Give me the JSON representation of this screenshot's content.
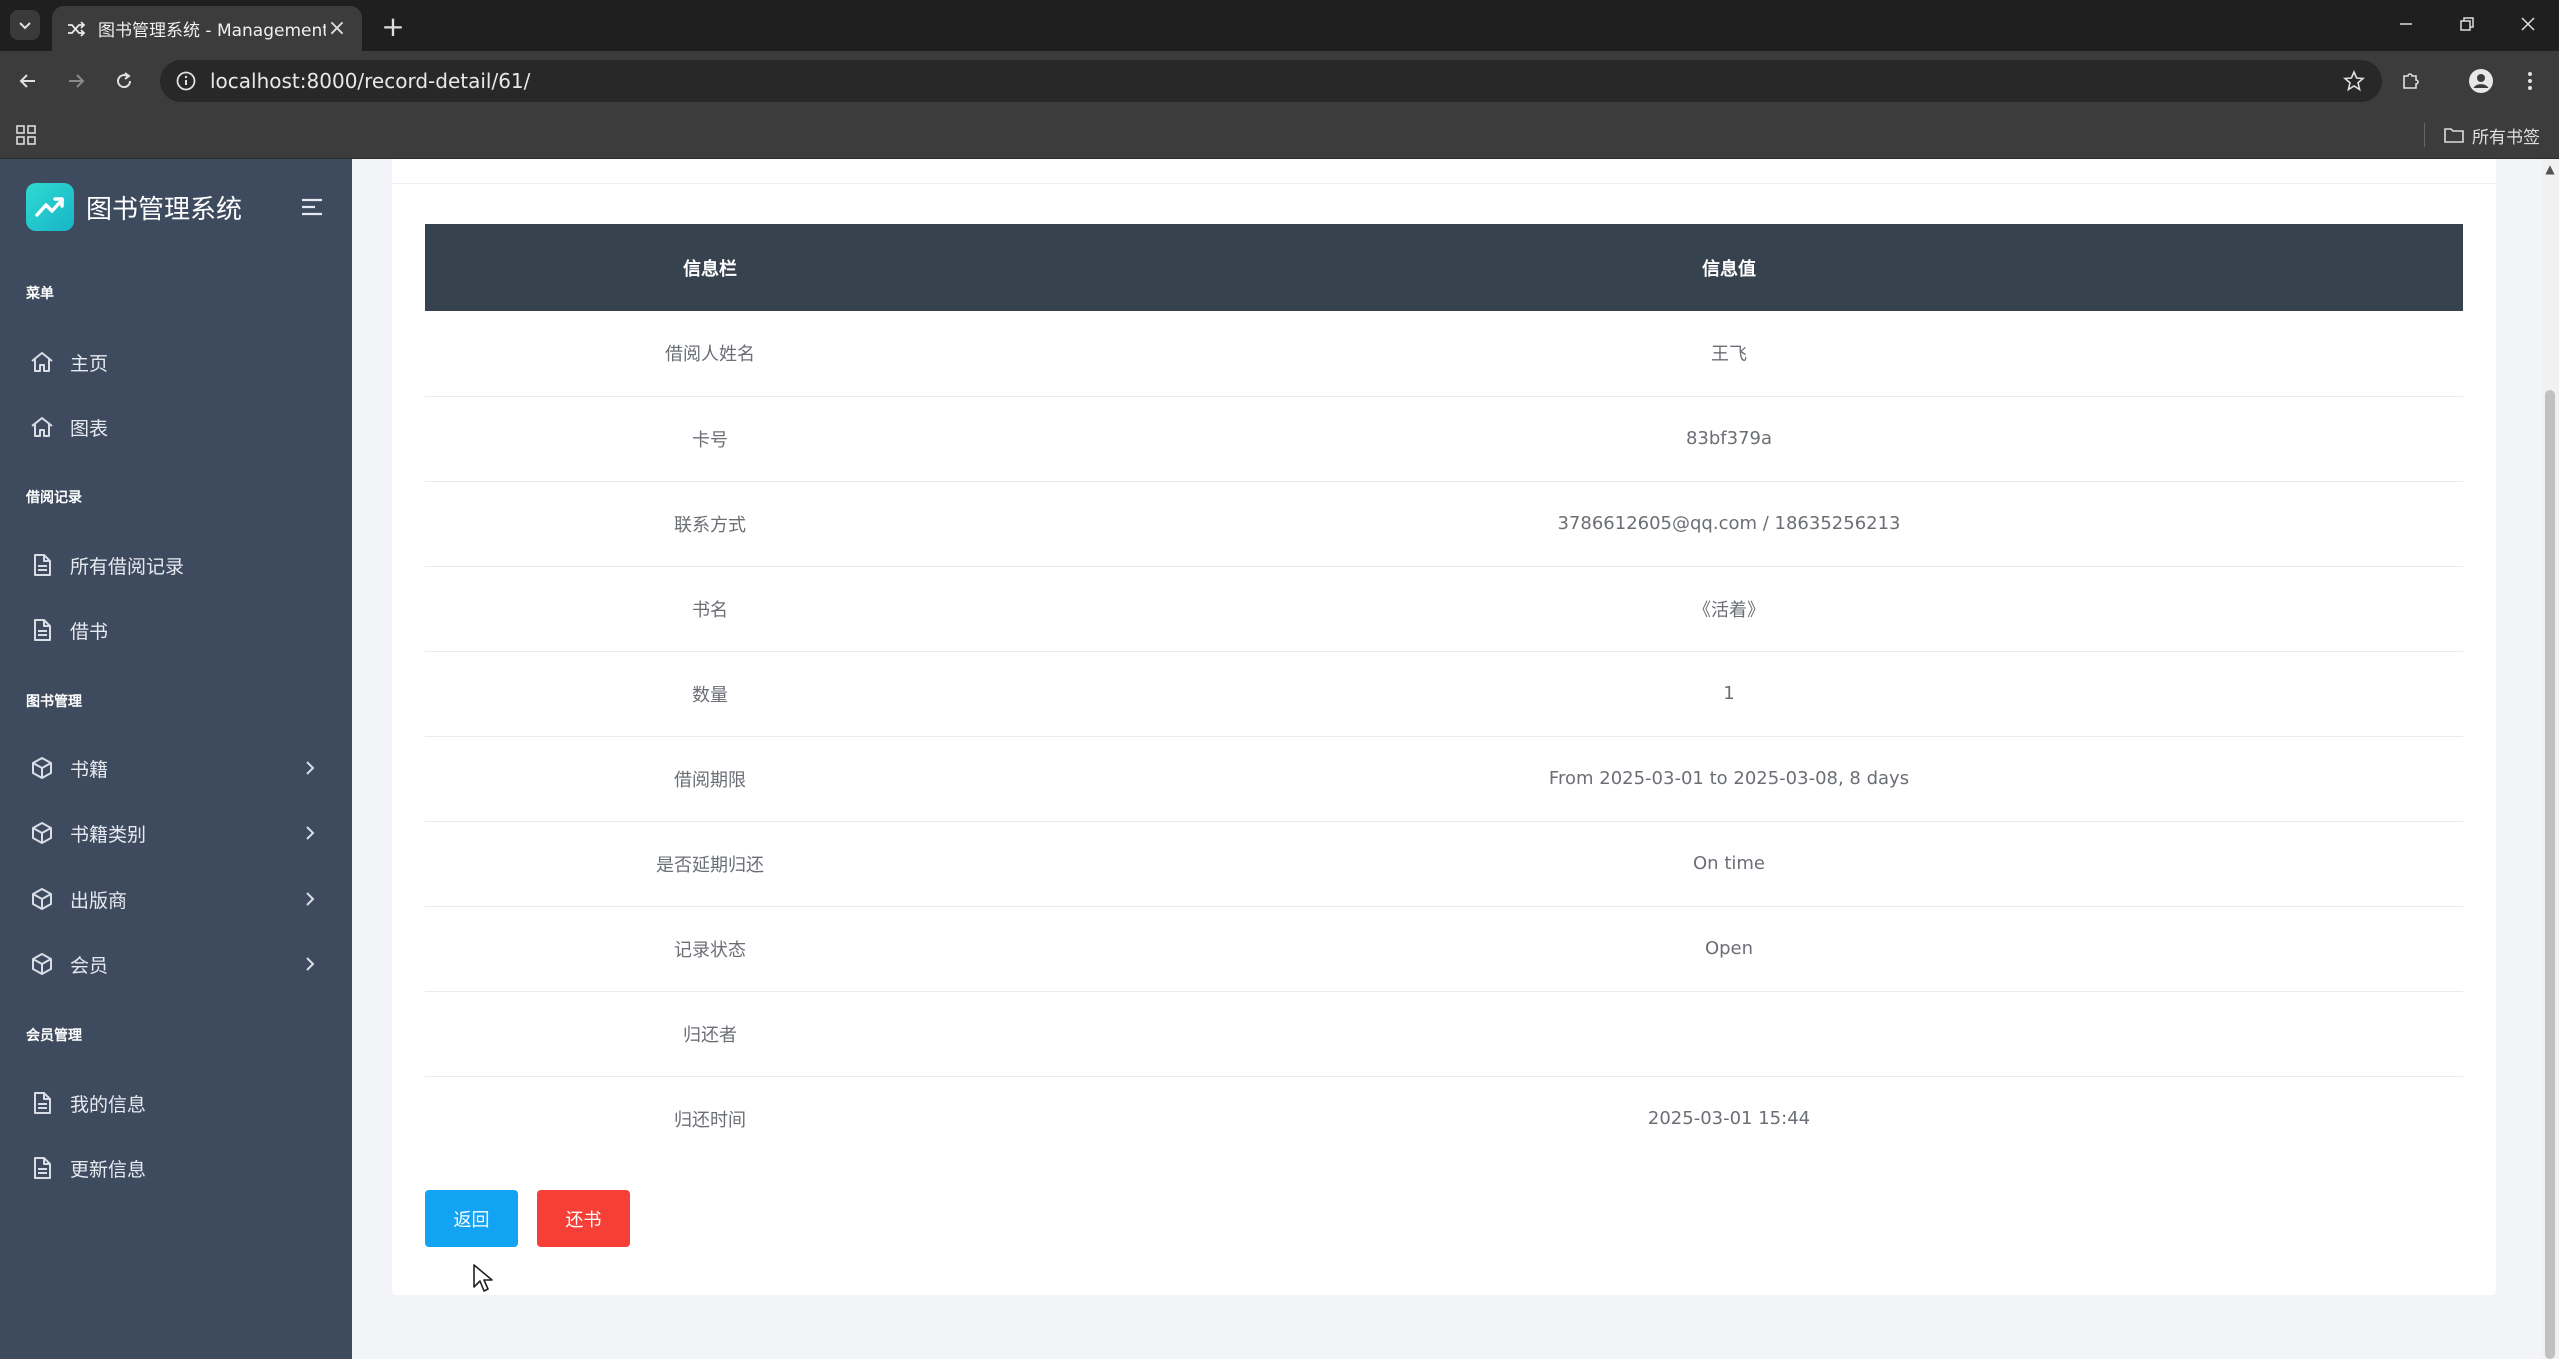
{
  "browser": {
    "tab_title": "图书管理系统 - Management",
    "new_tab_symbol": "+",
    "close_symbol": "×",
    "url": "localhost:8000/record-detail/61/",
    "bookmarks_folder": "所有书签"
  },
  "sidebar": {
    "brand": "图书管理系统",
    "sections": {
      "menu": "菜单",
      "borrow_records": "借阅记录",
      "book_management": "图书管理",
      "member_management": "会员管理"
    },
    "items": {
      "home": "主页",
      "charts": "图表",
      "all_records": "所有借阅记录",
      "borrow_book": "借书",
      "books": "书籍",
      "categories": "书籍类别",
      "publishers": "出版商",
      "members": "会员",
      "my_info": "我的信息",
      "update_info": "更新信息"
    }
  },
  "table": {
    "headers": [
      "信息栏",
      "信息值"
    ],
    "rows": [
      {
        "field": "借阅人姓名",
        "value": "王飞"
      },
      {
        "field": "卡号",
        "value": "83bf379a"
      },
      {
        "field": "联系方式",
        "value": "3786612605@qq.com / 18635256213"
      },
      {
        "field": "书名",
        "value": "《活着》"
      },
      {
        "field": "数量",
        "value": "1"
      },
      {
        "field": "借阅期限",
        "value": "From 2025-03-01 to 2025-03-08, 8 days"
      },
      {
        "field": "是否延期归还",
        "value": "On time"
      },
      {
        "field": "记录状态",
        "value": "Open"
      },
      {
        "field": "归还者",
        "value": ""
      },
      {
        "field": "归还时间",
        "value": "2025-03-01 15:44"
      }
    ]
  },
  "actions": {
    "back": "返回",
    "return_book": "还书"
  },
  "colors": {
    "sidebar_bg": "#3e4b5f",
    "table_header_bg": "#37424f",
    "back_button": "#12a4f3",
    "return_button": "#f53f37"
  }
}
